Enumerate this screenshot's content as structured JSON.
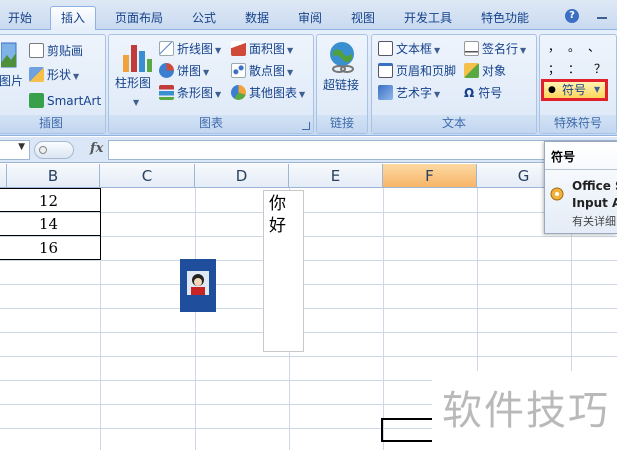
{
  "tabs": [
    {
      "label": "开始",
      "active": false
    },
    {
      "label": "插入",
      "active": true
    },
    {
      "label": "页面布局",
      "active": false
    },
    {
      "label": "公式",
      "active": false
    },
    {
      "label": "数据",
      "active": false
    },
    {
      "label": "审阅",
      "active": false
    },
    {
      "label": "视图",
      "active": false
    },
    {
      "label": "开发工具",
      "active": false
    },
    {
      "label": "特色功能",
      "active": false
    }
  ],
  "help_glyph": "?",
  "ribbon": {
    "illustrations": {
      "caption": "插图",
      "picture_label": "图片",
      "clipart_label": "剪贴画",
      "shapes_label": "形状",
      "smartart_label": "SmartArt"
    },
    "charts": {
      "caption": "图表",
      "column_label": "柱形图",
      "line_label": "折线图",
      "pie_label": "饼图",
      "bar_label": "条形图",
      "area_label": "面积图",
      "scatter_label": "散点图",
      "other_label": "其他图表"
    },
    "links": {
      "caption": "链接",
      "hyperlink_label": "超链接"
    },
    "text": {
      "caption": "文本",
      "textbox_label": "文本框",
      "headerfooter_label": "页眉和页脚",
      "wordart_label": "艺术字",
      "signature_label": "签名行",
      "object_label": "对象",
      "symbol_label": "符号"
    },
    "special_symbols": {
      "caption": "特殊符号",
      "row1": [
        "，",
        "。",
        "、"
      ],
      "row2": [
        "；",
        "：",
        "？"
      ],
      "symbol_button_label": "符号",
      "symbol_glyph": "●"
    }
  },
  "formula_bar": {
    "fx_label": "fx",
    "name_box_value": "",
    "formula_value": ""
  },
  "columns": [
    "B",
    "C",
    "D",
    "E",
    "F",
    "G"
  ],
  "selected_column": "F",
  "cells": {
    "b1": "12",
    "b2": "14",
    "b3": "16"
  },
  "comment_text": [
    "你",
    "好"
  ],
  "tooltip": {
    "title": "符号",
    "line1": "Office S",
    "line2": "Input A",
    "line3": "有关详细"
  },
  "watermark": "软件技巧"
}
